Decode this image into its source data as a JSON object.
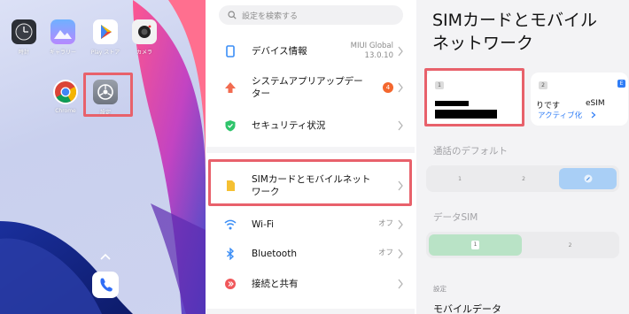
{
  "home": {
    "apps_row1": [
      {
        "label": "時計"
      },
      {
        "label": "ギャラリー"
      },
      {
        "label": "Play ストア"
      },
      {
        "label": "カメラ"
      }
    ],
    "apps_row2": [
      {
        "label": "Chrome"
      },
      {
        "label": "設定"
      }
    ]
  },
  "settings": {
    "search_placeholder": "設定を検索する",
    "items": [
      {
        "label": "デバイス情報",
        "value_line1": "MIUI Global",
        "value_line2": "13.0.10"
      },
      {
        "label_line1": "システムアプリアップデー",
        "label_line2": "ター",
        "badge": "4"
      },
      {
        "label": "セキュリティ状況"
      },
      {
        "label_line1": "SIMカードとモバイルネット",
        "label_line2": "ワーク"
      },
      {
        "label": "Wi-Fi",
        "value": "オフ"
      },
      {
        "label": "Bluetooth",
        "value": "オフ"
      },
      {
        "label": "接続と共有"
      }
    ]
  },
  "sim": {
    "title_line1": "SIMカードとモバイル",
    "title_line2": "ネットワーク",
    "sim1_slot": "1",
    "sim2_slot": "2",
    "sim2_carrier": "りです",
    "sim2_type": "eSIM",
    "sim2_action": "アクティブ化",
    "sim2_indicator": "E",
    "call_default_label": "通話のデフォルト",
    "call_options": [
      "1",
      "2"
    ],
    "data_sim_label": "データSIM",
    "data_options": [
      "1",
      "2"
    ],
    "settings_label": "設定",
    "mobile_data_label": "モバイルデータ"
  },
  "colors": {
    "highlight": "#e8616b",
    "accent_blue": "#2f7df6",
    "active_green": "#b9e3c6",
    "active_blue": "#a9cff6"
  }
}
